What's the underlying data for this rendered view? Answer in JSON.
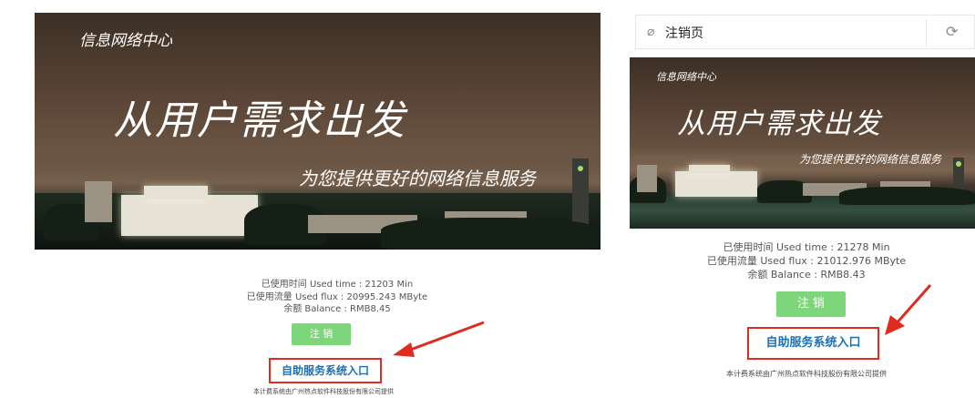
{
  "left": {
    "banner": {
      "subtitle": "信息网络中心",
      "headline": "从用户需求出发",
      "tagline": "为您提供更好的网络信息服务"
    },
    "info": {
      "used_time": "已使用时间 Used time : 21203 Min",
      "used_flux": "已使用流量 Used flux : 20995.243 MByte",
      "balance": "余额 Balance : RMB8.45"
    },
    "logout_label": "注 销",
    "self_service_label": "自助服务系统入口",
    "footer": "本计费系统由广州热点软件科技股份有限公司提供"
  },
  "right": {
    "browser": {
      "page_title": "注销页",
      "link_icon": "link-icon",
      "reload_icon": "reload-icon"
    },
    "banner": {
      "subtitle": "信息网络中心",
      "headline": "从用户需求出发",
      "tagline": "为您提供更好的网络信息服务"
    },
    "info": {
      "used_time": "已使用时间 Used time : 21278 Min",
      "used_flux": "已使用流量 Used flux : 21012.976 MByte",
      "balance": "余额 Balance : RMB8.43"
    },
    "logout_label": "注 销",
    "self_service_label": "自助服务系统入口",
    "footer": "本计费系统由广州热点软件科技股份有限公司提供"
  },
  "colors": {
    "logout_green": "#7ed67a",
    "highlight_red": "#e02b20",
    "link_blue": "#1b70b8"
  }
}
